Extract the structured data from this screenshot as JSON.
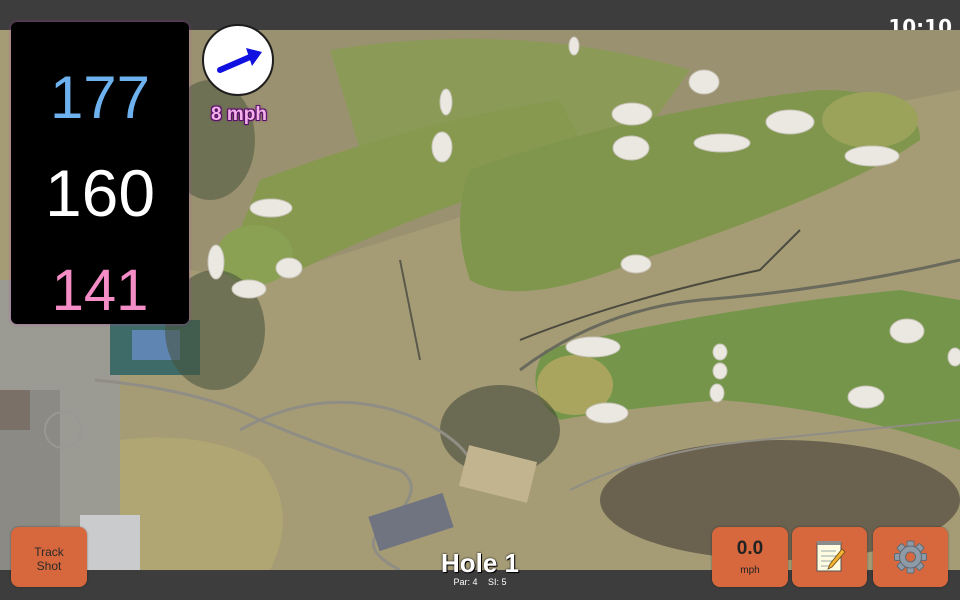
{
  "status": {
    "time": "10:10"
  },
  "distances": {
    "back": "177",
    "middle": "160",
    "front": "141"
  },
  "wind": {
    "speed": "8 mph",
    "direction_icon": "arrow-right-icon"
  },
  "hole": {
    "title": "Hole 1",
    "par": "Par: 4",
    "si": "SI: 5"
  },
  "buttons": {
    "track_line1": "Track",
    "track_line2": "Shot",
    "speed_value": "0.0",
    "speed_unit": "mph",
    "notes_icon": "notepad-icon",
    "settings_icon": "gear-icon"
  },
  "colors": {
    "back": "#6db2ef",
    "middle": "#ffffff",
    "front": "#f48cc6",
    "button": "#d7683d",
    "wind_text": "#f3b0ea"
  }
}
